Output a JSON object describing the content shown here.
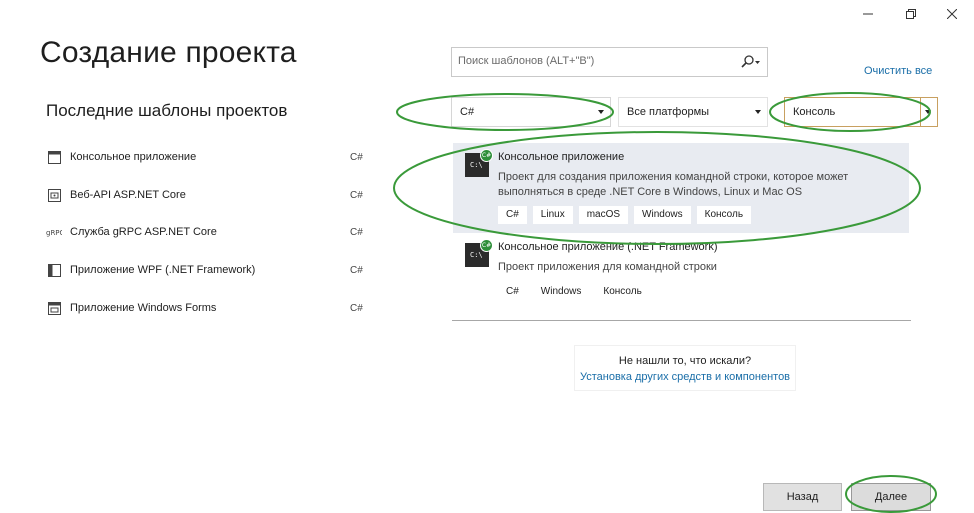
{
  "window": {
    "controls": [
      "minimize-icon",
      "restore-icon",
      "close-icon"
    ]
  },
  "page_title": "Создание проекта",
  "recent": {
    "title": "Последние шаблоны проектов",
    "items": [
      {
        "label": "Консольное приложение",
        "lang": "C#",
        "icon": "console-app-icon"
      },
      {
        "label": "Веб-API ASP.NET Core",
        "lang": "C#",
        "icon": "web-api-icon"
      },
      {
        "label": "Служба gRPC ASP.NET Core",
        "lang": "C#",
        "icon": "grpc-icon"
      },
      {
        "label": "Приложение WPF (.NET Framework)",
        "lang": "C#",
        "icon": "wpf-icon"
      },
      {
        "label": "Приложение Windows Forms",
        "lang": "C#",
        "icon": "winforms-icon"
      }
    ]
  },
  "search": {
    "placeholder": "Поиск шаблонов (ALT+\"В\")",
    "value": ""
  },
  "clear_all": "Очистить все",
  "filters": {
    "language": "C#",
    "platform": "Все платформы",
    "project_type": "Консоль"
  },
  "templates": [
    {
      "title": "Консольное приложение",
      "description": "Проект для создания приложения командной строки, которое может выполняться в среде .NET Core в Windows, Linux и Mac OS",
      "tags": [
        "C#",
        "Linux",
        "macOS",
        "Windows",
        "Консоль"
      ],
      "selected": true
    },
    {
      "title": "Консольное приложение (.NET Framework)",
      "description": "Проект приложения для командной строки",
      "tags": [
        "C#",
        "Windows",
        "Консоль"
      ],
      "selected": false
    }
  ],
  "not_found": {
    "question": "Не нашли то, что искали?",
    "link": "Установка других средств и компонентов"
  },
  "buttons": {
    "back": "Назад",
    "next": "Далее"
  },
  "colors": {
    "accent_link": "#1a6ea8",
    "annotation": "#3a9a3a",
    "selected_bg": "#e8ebf1",
    "type_filter_border": "#c8a060"
  }
}
